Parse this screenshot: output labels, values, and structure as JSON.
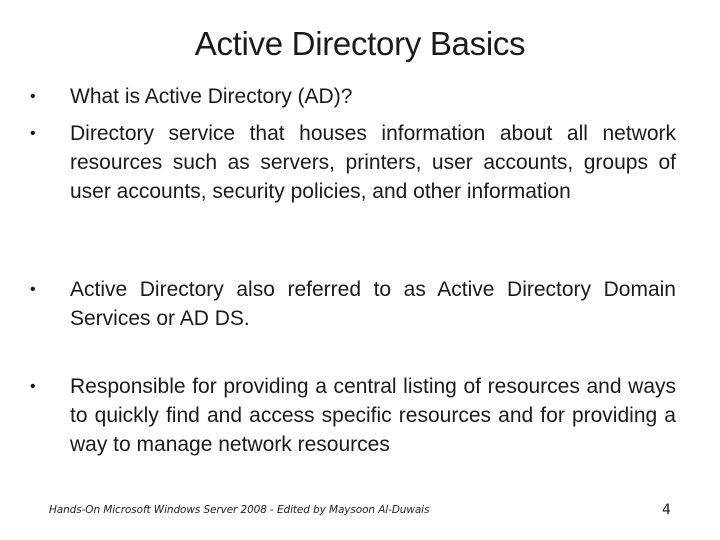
{
  "slide": {
    "title": "Active Directory Basics",
    "bullet_char": "•",
    "bullets": [
      {
        "text": "What is Active Directory (AD)?"
      },
      {
        "text": "Directory service that houses information about all network resources such as servers, printers, user accounts, groups of user accounts, security policies, and other information"
      },
      {
        "text": "Active Directory also referred to as Active Directory Domain Services or AD DS."
      },
      {
        "text": "Responsible for providing a central listing of resources and ways to quickly find and access specific resources and for providing a way to manage network resources"
      }
    ],
    "footer": "Hands-On Microsoft Windows Server 2008 - Edited by Maysoon Al-Duwais",
    "page_number": "4"
  }
}
